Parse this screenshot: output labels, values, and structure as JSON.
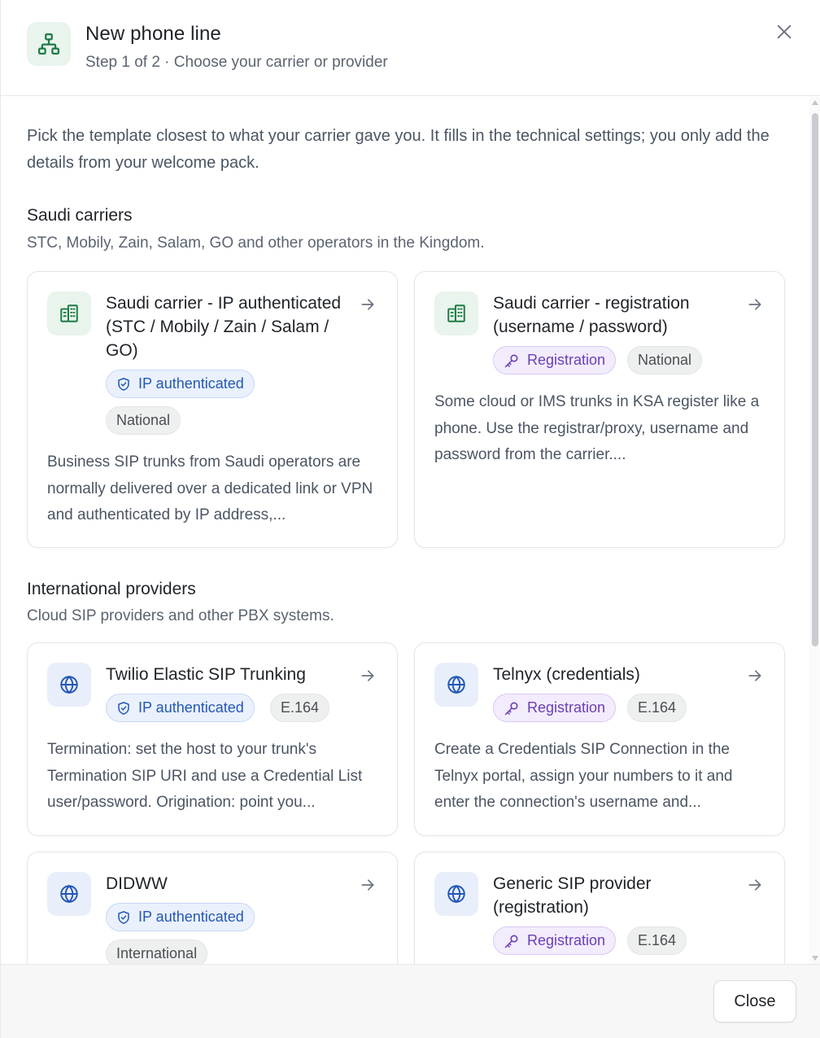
{
  "dialog": {
    "title": "New phone line",
    "subtitle": "Step 1 of 2 · Choose your carrier or provider",
    "intro": "Pick the template closest to what your carrier gave you. It fills in the technical settings; you only add the details from your welcome pack."
  },
  "sections": {
    "saudi": {
      "title": "Saudi carriers",
      "subtitle": "STC, Mobily, Zain, Salam, GO and other operators in the Kingdom."
    },
    "international": {
      "title": "International providers",
      "subtitle": "Cloud SIP providers and other PBX systems."
    }
  },
  "cards": {
    "saudi_ip": {
      "title": "Saudi carrier - IP authenticated (STC / Mobily / Zain / Salam / GO)",
      "badges": [
        "IP authenticated",
        "National"
      ],
      "description": "Business SIP trunks from Saudi operators are normally delivered over a dedicated link or VPN and authenticated by IP address,..."
    },
    "saudi_reg": {
      "title": "Saudi carrier - registration (username / password)",
      "badges": [
        "Registration",
        "National"
      ],
      "description": "Some cloud or IMS trunks in KSA register like a phone. Use the registrar/proxy, username and password from the carrier...."
    },
    "twilio": {
      "title": "Twilio Elastic SIP Trunking",
      "badges": [
        "IP authenticated",
        "E.164"
      ],
      "description": "Termination: set the host to your trunk's Termination SIP URI and use a Credential List user/password. Origination: point you..."
    },
    "telnyx": {
      "title": "Telnyx (credentials)",
      "badges": [
        "Registration",
        "E.164"
      ],
      "description": "Create a Credentials SIP Connection in the Telnyx portal, assign your numbers to it and enter the connection's username and..."
    },
    "didww": {
      "title": "DIDWW",
      "badges": [
        "IP authenticated",
        "International"
      ]
    },
    "generic": {
      "title": "Generic SIP provider (registration)",
      "badges": [
        "Registration",
        "E.164"
      ]
    }
  },
  "footer": {
    "close_label": "Close"
  },
  "icons": {
    "header": "network-tree-icon",
    "carrier": "building-icon",
    "provider": "globe-icon",
    "ip_auth": "shield-check-icon",
    "registration": "key-icon",
    "open": "arrow-right-icon",
    "dismiss": "close-icon"
  },
  "colors": {
    "green_accent": "#1e7a46",
    "blue_accent": "#2357b8",
    "purple_accent": "#6a3fb5"
  }
}
